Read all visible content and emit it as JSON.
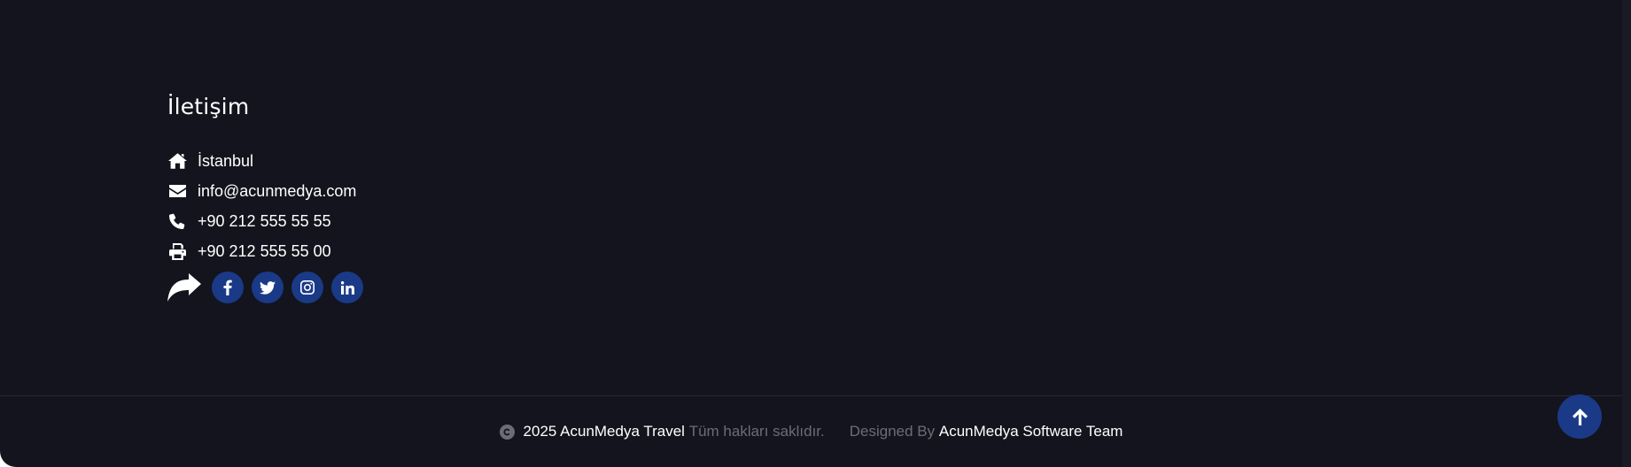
{
  "contact": {
    "heading": "İletişim",
    "address": "İstanbul",
    "email": "info@acunmedya.com",
    "phone": "+90 212 555 55 55",
    "fax": "+90 212 555 55 00"
  },
  "social": {
    "share_icon": "share-icon",
    "links": [
      "facebook",
      "twitter",
      "instagram",
      "linkedin"
    ]
  },
  "footer": {
    "copyright_year_brand": "2025 AcunMedya Travel",
    "rights": "Tüm hakları saklıdır.",
    "designed_by": "Designed By",
    "team": "AcunMedya Software Team"
  },
  "colors": {
    "background": "#13141d",
    "accent": "#1a3a87"
  }
}
